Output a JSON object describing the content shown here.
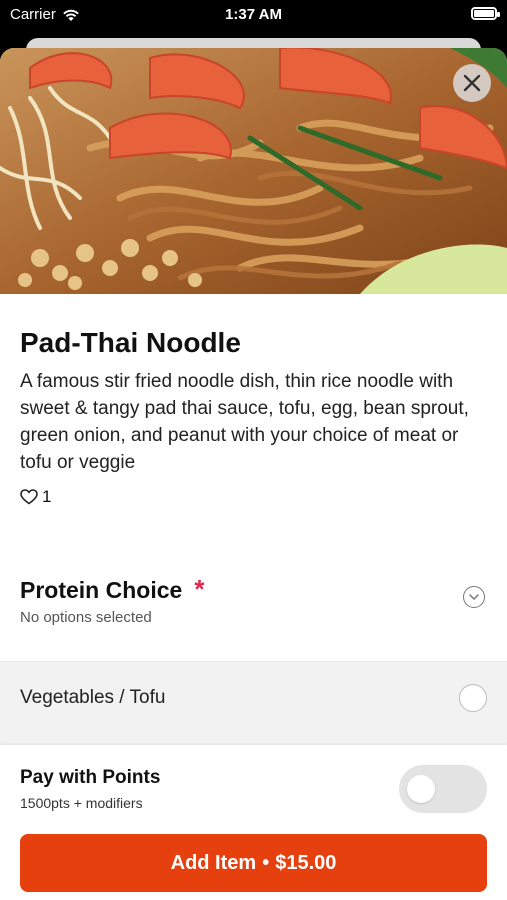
{
  "status_bar": {
    "carrier": "Carrier",
    "time": "1:37 AM"
  },
  "item": {
    "title": "Pad-Thai Noodle",
    "description": "A famous stir fried noodle dish, thin rice noodle with sweet & tangy pad thai sauce, tofu, egg, bean sprout, green onion, and peanut with your choice of meat or tofu or veggie",
    "likes": "1"
  },
  "modifier_group": {
    "title": "Protein Choice",
    "required_mark": "*",
    "subtitle": "No options selected",
    "options": [
      {
        "label": "Vegetables / Tofu",
        "selected": false
      }
    ]
  },
  "points": {
    "title": "Pay with Points",
    "subtitle": "1500pts + modifiers",
    "enabled": false
  },
  "add_button": {
    "label": "Add Item",
    "separator": "•",
    "price": "$15.00"
  },
  "colors": {
    "accent": "#e6400f",
    "required": "#e2264d"
  }
}
